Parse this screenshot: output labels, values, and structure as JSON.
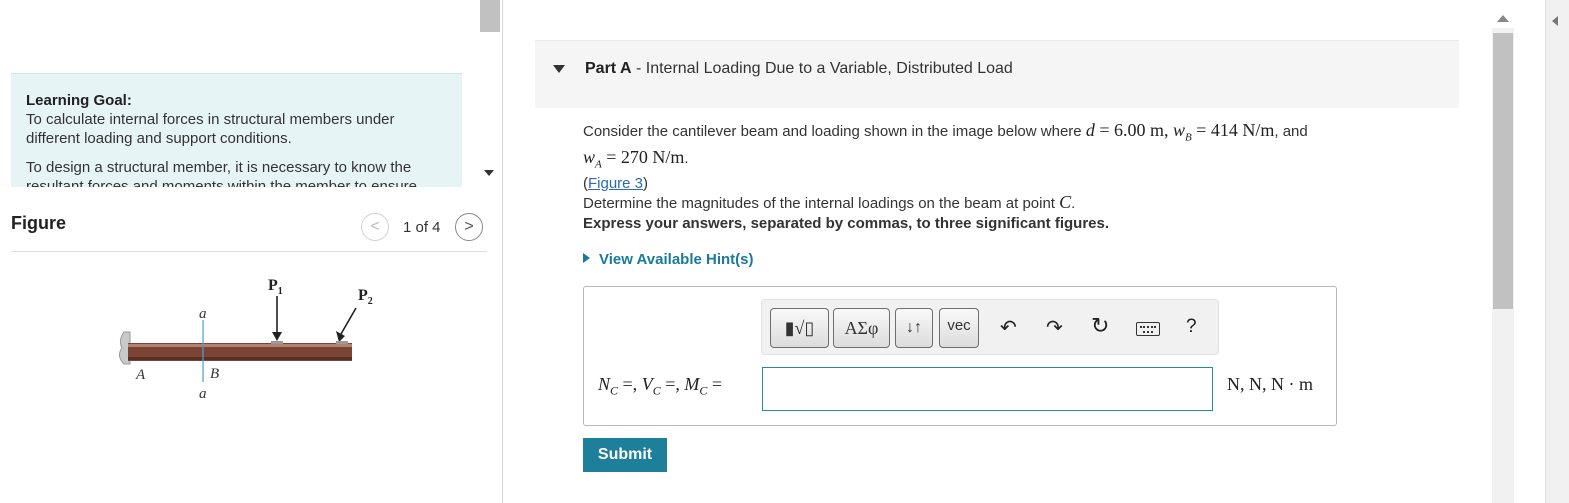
{
  "learning_goal": {
    "title": "Learning Goal:",
    "line1": "To calculate internal forces in structural members under different loading and support conditions.",
    "line2": "To design a structural member, it is necessary to know the resultant forces and moments within the member to ensure"
  },
  "figure": {
    "title": "Figure",
    "counter": "1 of 4",
    "prev_glyph": "<",
    "next_glyph": ">",
    "labels": {
      "p1": "P",
      "p1_sub": "1",
      "p2": "P",
      "p2_sub": "2",
      "a_top": "a",
      "a_bottom": "a",
      "A": "A",
      "B": "B"
    }
  },
  "part": {
    "label": "Part A",
    "separator": " - ",
    "title": "Internal Loading Due to a Variable, Distributed Load"
  },
  "question": {
    "intro": "Consider the cantilever beam and loading shown in the image below where",
    "d_symbol": "d",
    "d_value": "= 6.00 m",
    "wb_symbol": "w",
    "wb_sub": "B",
    "wb_value": "= 414 N/m",
    "and": ", and",
    "wa_symbol": "w",
    "wa_sub": "A",
    "wa_value": "= 270 N/m",
    "period": ".",
    "figure_link": "Figure 3",
    "task_prefix": "Determine the magnitudes of the internal loadings on the beam at point",
    "point": "C",
    "task_suffix": "."
  },
  "instruction": "Express your answers, separated by commas, to three significant figures.",
  "hint_label": "View Available Hint(s)",
  "toolbar": {
    "templates": "▮√▯",
    "symbols": "ΑΣφ",
    "arrows": "↓↑",
    "vec": "vec",
    "undo": "↶",
    "redo": "↷",
    "reset": "↻",
    "help": "?"
  },
  "answer": {
    "label": "N_C =, V_C =, M_C =",
    "value": "",
    "units": "N, N, N · m"
  },
  "submit_label": "Submit"
}
